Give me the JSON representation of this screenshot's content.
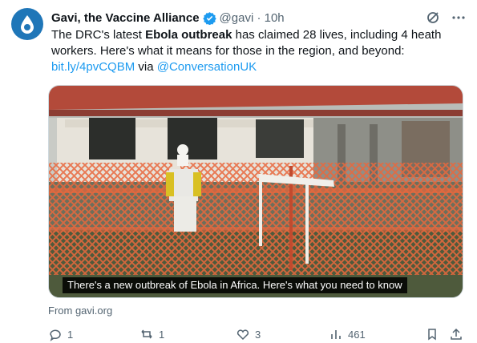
{
  "tweet": {
    "author": "Gavi, the Vaccine Alliance",
    "handle_time": "@gavi · 10h",
    "text_before": "The DRC's latest ",
    "text_bold": "Ebola outbreak",
    "text_after": " has claimed 28 lives, including 4 heath workers. Here's what it means for those in the region, and beyond:",
    "link": "bit.ly/4pvCQBM",
    "via": " via ",
    "mention": "@ConversationUK"
  },
  "card": {
    "caption": "There's a new outbreak of Ebola in Africa. Here's what you need to know",
    "source": "From gavi.org"
  },
  "actions": {
    "replies": "1",
    "retweets": "1",
    "likes": "3",
    "views": "461"
  },
  "icons": {
    "avatar": "gavi-logo-icon",
    "verified": "verified-badge-icon",
    "grok": "grok-icon",
    "more": "more-icon",
    "reply": "reply-icon",
    "retweet": "retweet-icon",
    "like": "like-icon",
    "views": "views-icon",
    "bookmark": "bookmark-icon",
    "share": "share-icon"
  },
  "colors": {
    "accent": "#1d9bf0",
    "secondary_text": "#536471",
    "avatar_bg": "#1f76b8"
  }
}
